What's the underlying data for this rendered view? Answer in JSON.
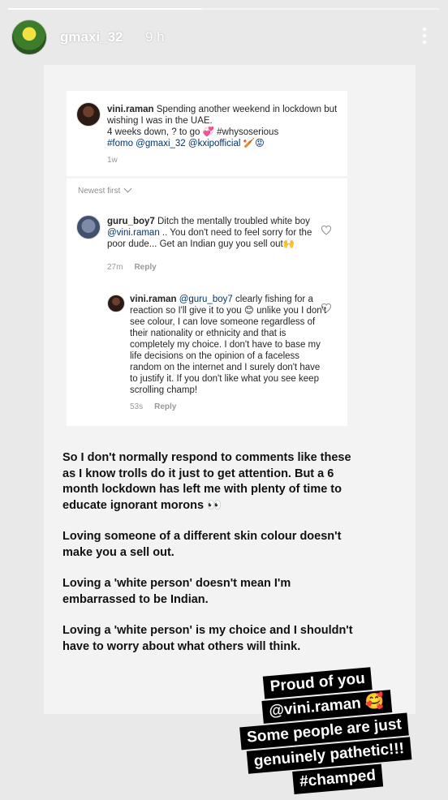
{
  "story": {
    "progress": 0.45,
    "header": {
      "username": "gmaxi_32",
      "time": "9 h"
    }
  },
  "screenshot": {
    "post": {
      "username": "vini.raman",
      "caption_start": " Spending another weekend in lockdown but wishing I was in the UAE.",
      "caption_line2": "4 weeks down, ? to go 💞 #whysoserious",
      "caption_line3": "#fomo @gmaxi_32 @kxipofficial 🏏😡",
      "time": "1w"
    },
    "sort_label": "Newest first",
    "comments": [
      {
        "username": "guru_boy7",
        "text_before": " Ditch the mentally troubled white boy ",
        "mention": "@vini.raman",
        "text_after": " .. You don't need to feel sorry for the poor dude... Get an Indian guy you sell out🙌",
        "time": "27m",
        "reply": "Reply"
      },
      {
        "username": "vini.raman",
        "mention": "@guru_boy7",
        "text_after": " clearly fishing for a reaction so I'll give it to you 😊 unlike you I don't see colour, I can love someone regardless of their nationality or ethnicity and that is completely my choice. I don't have to base my life decisions on the opinion of a faceless random on the internet and I surely don't have to justify it. If you don't like what you see keep scrolling champ!",
        "time": "53s",
        "reply": "Reply"
      }
    ]
  },
  "caption": [
    "So I don't normally respond to comments like these as I know trolls do it just to get attention. But a 6 month lockdown has left me with plenty of time to educate ignorant morons 👀",
    "Loving someone of a different skin colour doesn't make you a sell out.",
    "Loving a 'white person' doesn't mean I'm embarrassed to be Indian.",
    "Loving a 'white person' is my choice and I shouldn't have to worry about what others will think."
  ],
  "sticker": {
    "line1": "Proud of you",
    "line2": "@vini.raman 🥰",
    "line3": "Some people are just",
    "line4": "genuinely pathetic!!!",
    "line5": "#champed"
  },
  "colors": {
    "mention": "#003569",
    "muted": "#999999",
    "background": "#e9e9e9"
  }
}
